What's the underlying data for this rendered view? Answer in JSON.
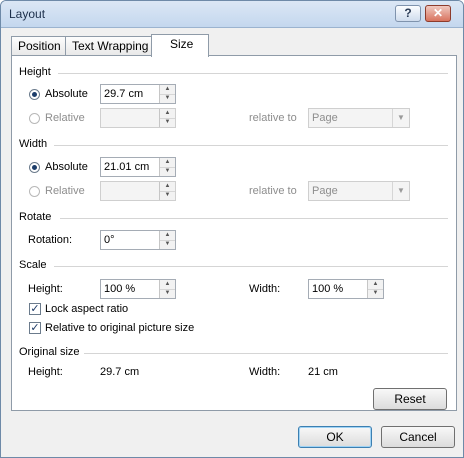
{
  "window": {
    "title": "Layout",
    "help_label": "?",
    "close_label": "✕"
  },
  "tabs": [
    {
      "label": "Position"
    },
    {
      "label": "Text Wrapping"
    },
    {
      "label": "Size"
    }
  ],
  "height": {
    "section": "Height",
    "absolute_label": "Absolute",
    "absolute_value": "29.7 cm",
    "relative_label": "Relative",
    "relative_value": "",
    "relative_to_label": "relative to",
    "relative_to_value": "Page"
  },
  "width": {
    "section": "Width",
    "absolute_label": "Absolute",
    "absolute_value": "21.01 cm",
    "relative_label": "Relative",
    "relative_value": "",
    "relative_to_label": "relative to",
    "relative_to_value": "Page"
  },
  "rotate": {
    "section": "Rotate",
    "label": "Rotation:",
    "value": "0°"
  },
  "scale": {
    "section": "Scale",
    "height_label": "Height:",
    "height_value": "100 %",
    "width_label": "Width:",
    "width_value": "100 %",
    "lock_aspect_label": "Lock aspect ratio",
    "lock_aspect_checked": true,
    "relative_original_label": "Relative to original picture size",
    "relative_original_checked": true
  },
  "original_size": {
    "section": "Original size",
    "height_label": "Height:",
    "height_value": "29.7 cm",
    "width_label": "Width:",
    "width_value": "21 cm"
  },
  "buttons": {
    "reset": "Reset",
    "ok": "OK",
    "cancel": "Cancel"
  },
  "icons": {
    "help": "help-icon",
    "close": "close-icon",
    "spin_up": "triangle-up-icon",
    "spin_down": "triangle-down-icon",
    "dropdown": "chevron-down-icon"
  }
}
